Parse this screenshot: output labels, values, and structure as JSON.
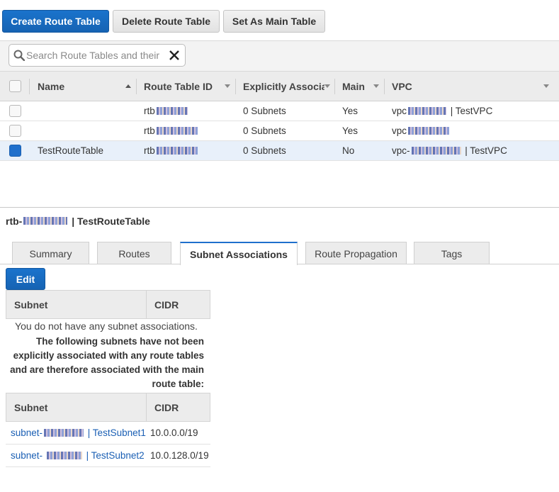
{
  "toolbar": {
    "create_label": "Create Route Table",
    "delete_label": "Delete Route Table",
    "set_main_label": "Set As Main Table"
  },
  "search": {
    "placeholder": "Search Route Tables and their"
  },
  "table": {
    "columns": [
      "Name",
      "Route Table ID",
      "Explicitly Associat",
      "Main",
      "VPC"
    ],
    "rows": [
      {
        "name": "",
        "id_prefix": "rtb",
        "explicit": "0 Subnets",
        "main": "Yes",
        "vpc_prefix": "vpc",
        "vpc_suffix": "| TestVPC",
        "selected": false
      },
      {
        "name": "",
        "id_prefix": "rtb",
        "explicit": "0 Subnets",
        "main": "Yes",
        "vpc_prefix": "vpc",
        "vpc_suffix": "",
        "selected": false
      },
      {
        "name": "TestRouteTable",
        "id_prefix": "rtb",
        "explicit": "0 Subnets",
        "main": "No",
        "vpc_prefix": "vpc-",
        "vpc_suffix": "| TestVPC",
        "selected": true
      }
    ]
  },
  "detail": {
    "title_prefix": "rtb-",
    "title_suffix": "| TestRouteTable",
    "tabs": [
      "Summary",
      "Routes",
      "Subnet Associations",
      "Route Propagation",
      "Tags"
    ],
    "active_tab": "Subnet Associations",
    "edit_label": "Edit",
    "assoc_table": {
      "col_subnet": "Subnet",
      "col_cidr": "CIDR"
    },
    "empty_message": "You do not have any subnet associations.",
    "note": "The following subnets have not been explicitly associated with any route tables and are therefore associated with the main route table:",
    "main_table": {
      "col_subnet": "Subnet",
      "col_cidr": "CIDR",
      "rows": [
        {
          "subnet_prefix": "subnet-",
          "subnet_name": "| TestSubnet1",
          "cidr": "10.0.0.0/19"
        },
        {
          "subnet_prefix": "subnet-",
          "subnet_name": "| TestSubnet2",
          "cidr": "10.0.128.0/19"
        }
      ]
    }
  },
  "colors": {
    "primary": "#1f6fcc",
    "link": "#1a5fb4",
    "selected_row": "#e8f0fa"
  }
}
